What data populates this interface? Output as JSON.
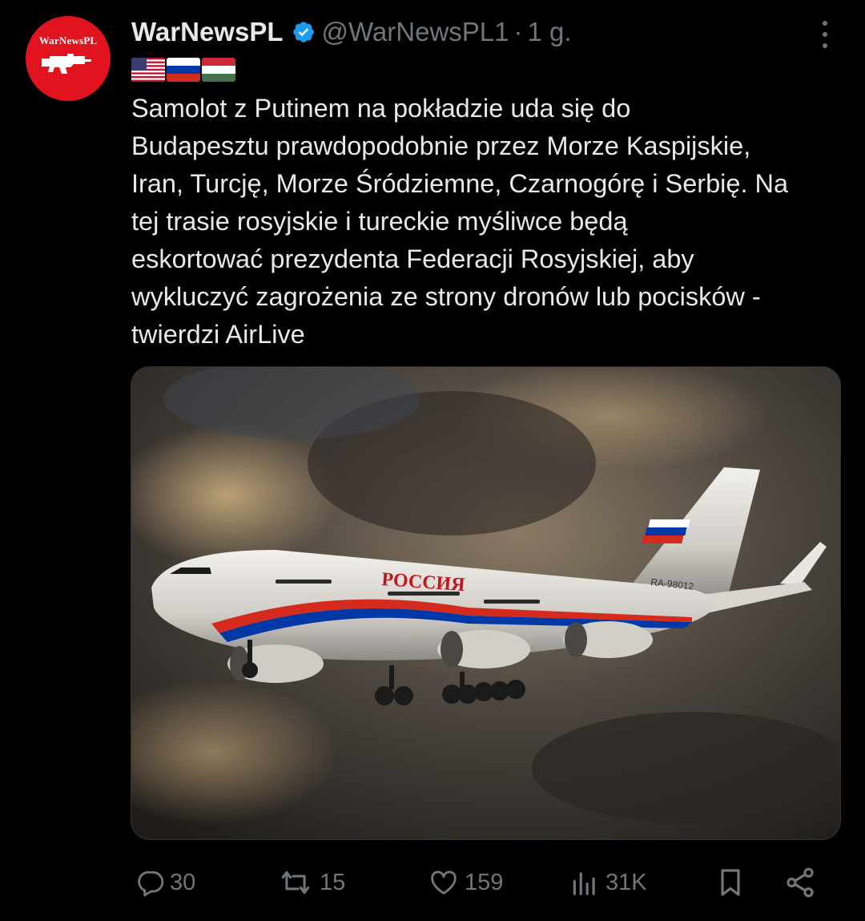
{
  "account": {
    "name": "WarNewsPL",
    "handle": "@WarNewsPL1",
    "separator": "·",
    "time": "1 g.",
    "avatar_text": "WarNewsPL",
    "verified_color": "#1d9bf0"
  },
  "tweet": {
    "flags": [
      "us-flag",
      "ru-flag",
      "hu-flag"
    ],
    "text": "Samolot z Putinem na pokładzie uda się do\nBudapesztu prawdopodobnie przez Morze Kaspijskie,\nIran, Turcję, Morze Śródziemne, Czarnogórę i Serbię. Na\ntej trasie rosyjskie i tureckie myśliwce będą\neskortować prezydenta Federacji Rosyjskiej, aby\nwykluczyć zagrożenia ze strony dronów lub pocisków -\ntwierdzi AirLive",
    "image": {
      "fuselage_text": "РОССИЯ",
      "registration": "RA-98012"
    }
  },
  "actions": {
    "replies": "30",
    "reposts": "15",
    "likes": "159",
    "views": "31K"
  },
  "colors": {
    "background": "#000000",
    "text": "#e7e9ea",
    "muted": "#71767b",
    "avatar_red": "#e0131f"
  }
}
